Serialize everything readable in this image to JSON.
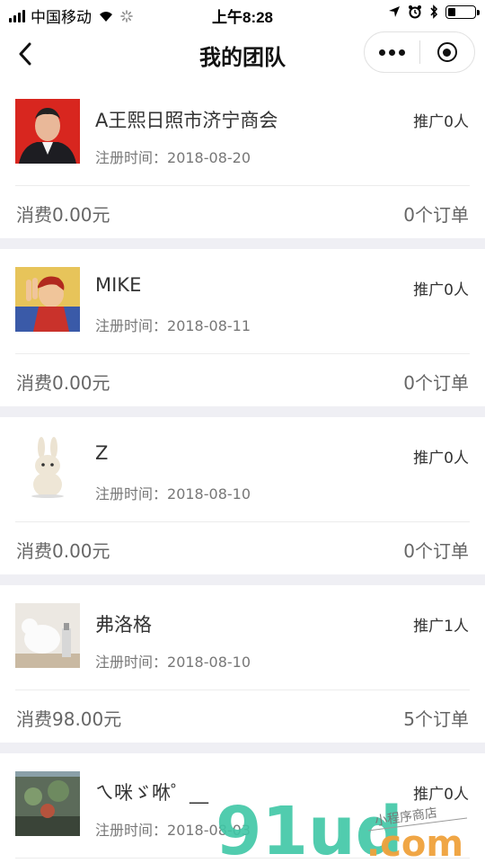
{
  "status_bar": {
    "carrier": "中国移动",
    "time": "上午8:28",
    "battery_level": 0.3
  },
  "nav": {
    "title": "我的团队"
  },
  "members": [
    {
      "name": "A王熙日照市济宁商会",
      "reg_label": "注册时间：",
      "reg_date": "2018-08-20",
      "promo": "推广0人",
      "spend": "消费0.00元",
      "orders": "0个订单",
      "avatar": "portrait-red"
    },
    {
      "name": "MIKE",
      "reg_label": "注册时间：",
      "reg_date": "2018-08-11",
      "promo": "推广0人",
      "spend": "消费0.00元",
      "orders": "0个订单",
      "avatar": "anime"
    },
    {
      "name": "Z",
      "reg_label": "注册时间：",
      "reg_date": "2018-08-10",
      "promo": "推广0人",
      "spend": "消费0.00元",
      "orders": "0个订单",
      "avatar": "rabbit"
    },
    {
      "name": "弗洛格",
      "reg_label": "注册时间：",
      "reg_date": "2018-08-10",
      "promo": "推广1人",
      "spend": "消费98.00元",
      "orders": "5个订单",
      "avatar": "cat"
    },
    {
      "name": "ㄟ咪ゞ咻゜__",
      "reg_label": "注册时间：",
      "reg_date": "2018-08-03",
      "promo": "推广0人",
      "spend": "",
      "orders": "",
      "avatar": "aquarium"
    }
  ],
  "watermark": {
    "big": "91ud",
    "dotcom": ".com",
    "small": "小程序商店"
  }
}
